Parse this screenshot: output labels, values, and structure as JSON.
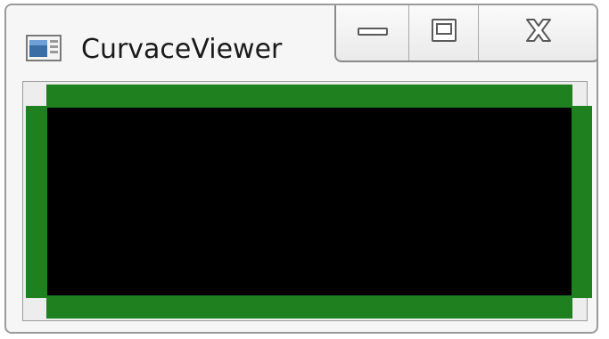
{
  "window": {
    "title": "CurvaceViewer",
    "app_icon": "application-window-icon"
  },
  "controls": {
    "minimize_icon": "minimize-icon",
    "maximize_icon": "maximize-icon",
    "close_icon": "close-icon"
  },
  "colors": {
    "frame_green": "#1f8020",
    "viewport_black": "#000000",
    "client_background": "#ededed",
    "window_chrome": "#f6f6f6"
  }
}
